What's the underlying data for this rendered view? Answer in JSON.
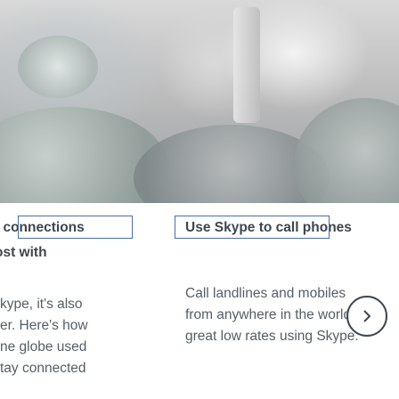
{
  "left_column": {
    "heading": ": connections",
    "heading_line2": "ost with",
    "paragraph_lines": [
      "kype, it's also",
      "er. Here's how",
      "ne globe used",
      "tay connected"
    ]
  },
  "right_column": {
    "heading": "Use Skype to call phones",
    "paragraph_lines": [
      "Call landlines and mobiles",
      "from anywhere in the world",
      "great low rates using Skype."
    ]
  },
  "carousel": {
    "next_icon": "chevron-right-icon"
  },
  "colors": {
    "heading_text": "#3e464e",
    "body_text": "#555e66",
    "focus_outline": "#4a6fa5"
  }
}
